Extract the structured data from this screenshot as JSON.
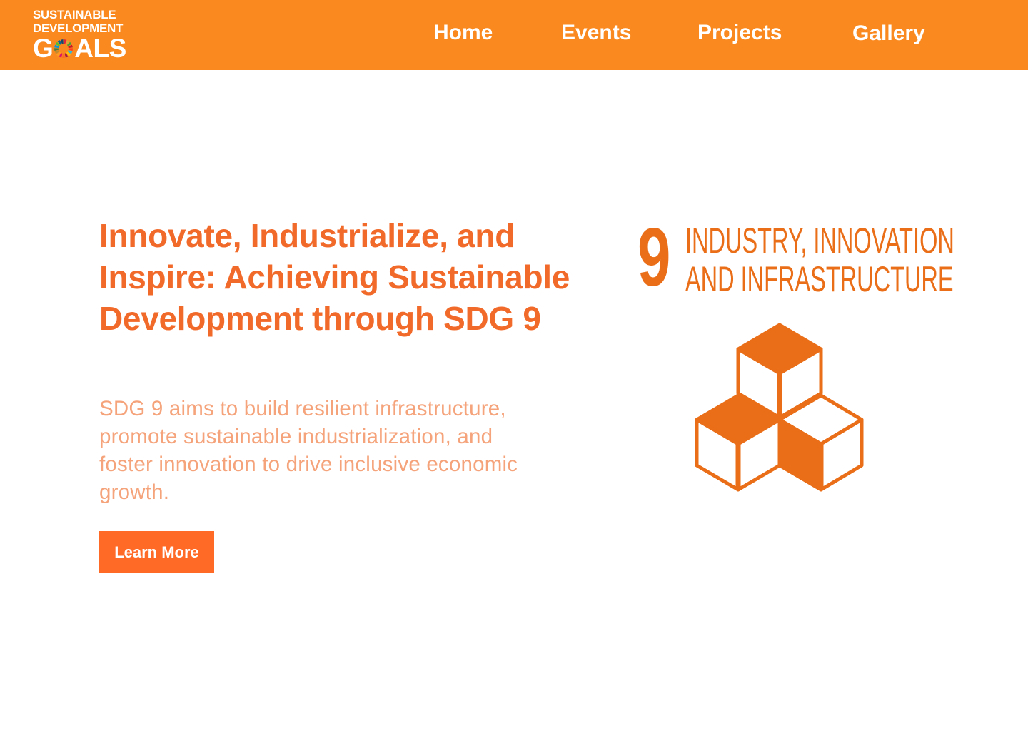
{
  "brand": {
    "logo_line1": "SUSTAINABLE",
    "logo_line2": "DEVELOPMENT",
    "logo_g": "G",
    "logo_als": "ALS",
    "primary_color": "#fa8a1f",
    "accent_color": "#f26a2a"
  },
  "nav": {
    "items": [
      {
        "label": "Home"
      },
      {
        "label": "Events"
      },
      {
        "label": "Projects"
      },
      {
        "label": "Gallery"
      }
    ]
  },
  "hero": {
    "title": "Innovate, Industrialize, and Inspire: Achieving Sustainable Development through SDG 9",
    "description": "SDG 9 aims to build resilient infrastructure, promote sustainable industrialization, and foster innovation to drive inclusive economic growth.",
    "cta_label": "Learn More"
  },
  "sdg": {
    "number": "9",
    "title_line1": "INDUSTRY, INNOVATION",
    "title_line2": "AND INFRASTRUCTURE",
    "icon": "stacked-cubes-icon",
    "color": "#ea6e17"
  }
}
